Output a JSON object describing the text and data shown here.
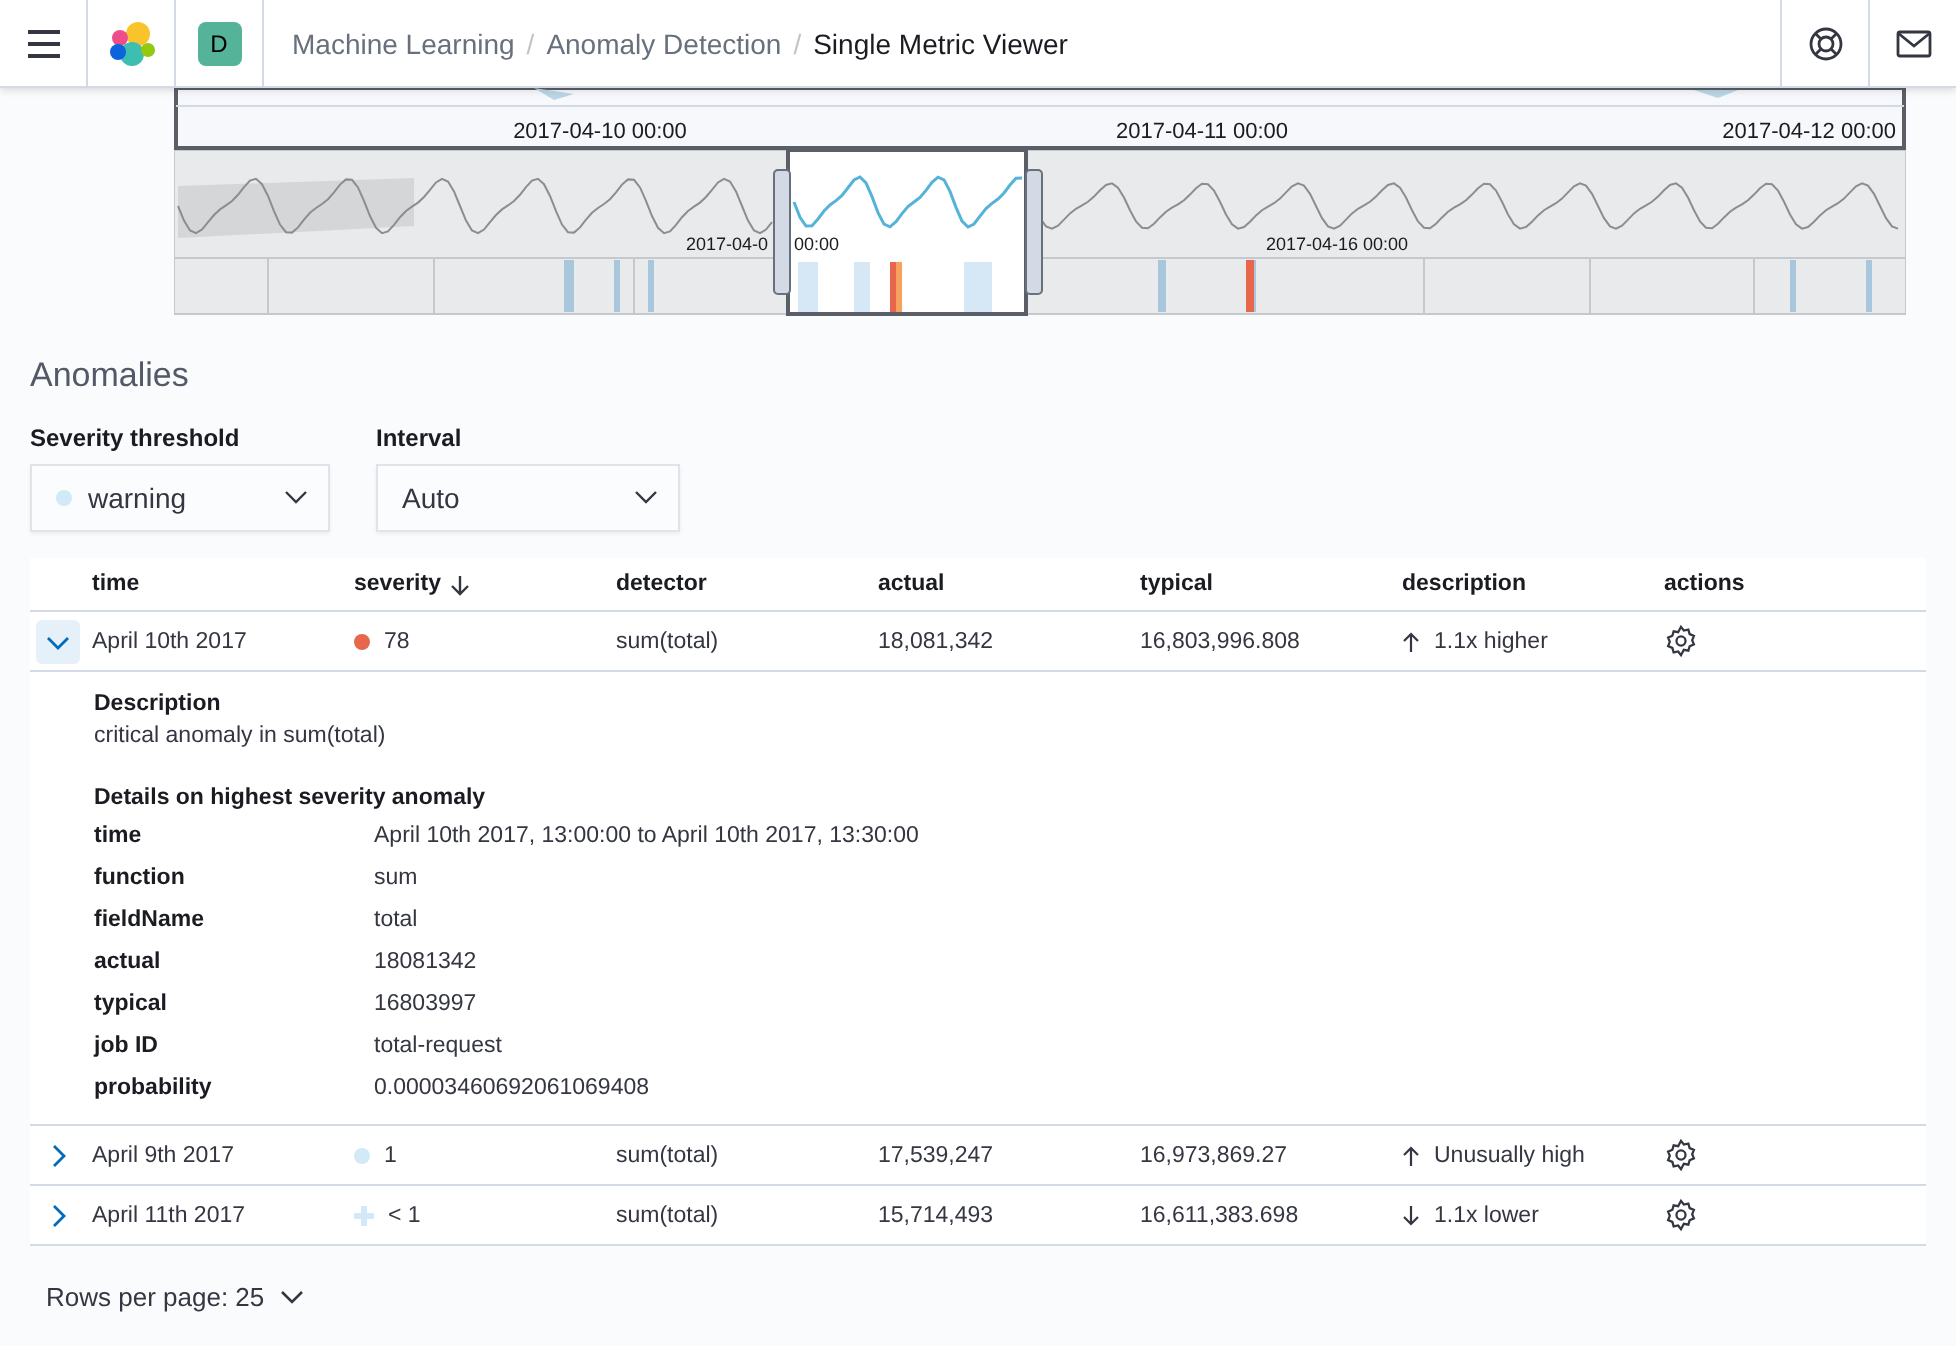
{
  "header": {
    "avatar": "D",
    "separator": "/",
    "breadcrumbs": [
      {
        "label": "Machine Learning",
        "current": false
      },
      {
        "label": "Anomaly Detection",
        "current": false
      },
      {
        "label": "Single Metric Viewer",
        "current": true
      }
    ]
  },
  "chart": {
    "focus_labels": [
      "2017-04-10 00:00",
      "2017-04-11 00:00",
      "2017-04-12 00:00"
    ],
    "context_labels": [
      "2017-04-0",
      "00:00",
      "2017-04-16 00:00"
    ]
  },
  "anomalies": {
    "title": "Anomalies",
    "severity_threshold": {
      "label": "Severity threshold",
      "value": "warning"
    },
    "interval": {
      "label": "Interval",
      "value": "Auto"
    },
    "columns": [
      {
        "label": "time",
        "sorted": false
      },
      {
        "label": "severity",
        "sorted": true
      },
      {
        "label": "detector",
        "sorted": false
      },
      {
        "label": "actual",
        "sorted": false
      },
      {
        "label": "typical",
        "sorted": false
      },
      {
        "label": "description",
        "sorted": false
      },
      {
        "label": "actions",
        "sorted": false
      }
    ],
    "rows": [
      {
        "time": "April 10th 2017",
        "severity": {
          "kind": "dot",
          "color": "#e7664c",
          "score": "78"
        },
        "detector": "sum(total)",
        "actual": "18,081,342",
        "typical": "16,803,996.808",
        "kind": "up",
        "description": "1.1x higher",
        "expanded": true,
        "details": {
          "description_heading": "Description",
          "description": "critical anomaly in sum(total)",
          "heading": "Details on highest severity anomaly",
          "fields": [
            {
              "label": "time",
              "value": "April 10th 2017, 13:00:00 to April 10th 2017, 13:30:00"
            },
            {
              "label": "function",
              "value": "sum"
            },
            {
              "label": "fieldName",
              "value": "total"
            },
            {
              "label": "actual",
              "value": "18081342"
            },
            {
              "label": "typical",
              "value": "16803997"
            },
            {
              "label": "job ID",
              "value": "total-request"
            },
            {
              "label": "probability",
              "value": "0.00003460692061069408"
            }
          ]
        }
      },
      {
        "time": "April 9th 2017",
        "severity": {
          "kind": "dot",
          "color": "#d2e9f7",
          "score": "1"
        },
        "detector": "sum(total)",
        "actual": "17,539,247",
        "typical": "16,973,869.27",
        "kind": "up",
        "description": "Unusually high",
        "expanded": false
      },
      {
        "time": "April 11th 2017",
        "severity": {
          "kind": "cross",
          "color": "#d2e9f7",
          "score": "< 1"
        },
        "detector": "sum(total)",
        "actual": "15,714,493",
        "typical": "16,611,383.698",
        "kind": "down",
        "description": "1.1x lower",
        "expanded": false
      }
    ],
    "pagination": "Rows per page: 25"
  }
}
